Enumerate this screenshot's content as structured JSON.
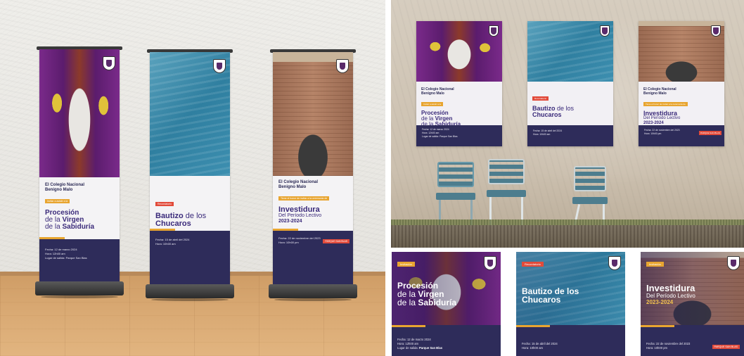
{
  "school": {
    "line1": "El Colegio Nacional",
    "line2": "Benigno Malo"
  },
  "banners": [
    {
      "tag": "Invitar a asistir a la",
      "title_light_1": "Procesión",
      "title_light_2": "de la",
      "title_bold_2": "Virgen",
      "title_light_3": "de la",
      "title_bold_3": "Sabiduría",
      "info1": "Fecha: 12 de marzo 2024",
      "info2": "Hora: 12h00 am",
      "info3": "Lugar de salida: Parque San Blas"
    },
    {
      "tag": "Recordatorio",
      "title_bold": "Bautizo",
      "title_light": "de los",
      "title_line2": "Chucaros",
      "info1": "Fecha: 15 de abril del 2024",
      "info2": "Hora: 10h00 am"
    },
    {
      "tag": "Tiene el honor de invitar a la ceremonia de",
      "title_bold": "Investidura",
      "title_light": "Del Período Lectivo",
      "title_year": "2023-2024",
      "info1": "Fecha: 22 de noviembre del 2023",
      "info2": "Hora: 10h00 pm",
      "right_tag": "PARQUE SAN BLAS"
    }
  ],
  "cards": [
    {
      "tag": "Invitación",
      "t1": "Procesión",
      "t2_light": "de la",
      "t2_bold": "Virgen",
      "t3_light": "de la",
      "t3_bold": "Sabiduría",
      "info1": "Fecha: 12 de marzo 2024",
      "info2": "Hora: 12h00 am",
      "info3_label": "Lugar de salida:",
      "info3_value": "Parque San Blas"
    },
    {
      "tag": "Recordatorio",
      "t1": "Bautizo de los",
      "t2": "Chucaros",
      "info1": "Fecha: 15 de abril del 2024",
      "info2": "Hora: 10h00 am"
    },
    {
      "tag": "Invitación",
      "t1": "Investidura",
      "t2": "Del Período Lectivo",
      "t3": "2023-2024",
      "info1": "Fecha: 22 de noviembre del 2023",
      "info2": "Hora: 10h00 pm",
      "right_tag": "PARQUE SAN BLAS"
    }
  ],
  "colors": {
    "navy": "#2e2c5a",
    "purple_text": "#3a2a7a",
    "accent_orange": "#e8a530",
    "accent_red": "#e24a3a"
  }
}
